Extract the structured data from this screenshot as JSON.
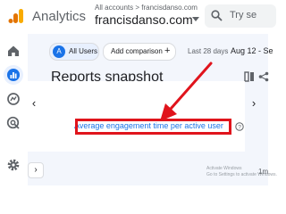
{
  "header": {
    "app_title": "Analytics",
    "account_crumb": "All accounts > francisdanso.com",
    "property_name": "francisdanso.com",
    "search_placeholder": "Try se"
  },
  "nav_rail": {
    "items": [
      {
        "icon": "home-icon"
      },
      {
        "icon": "reports-icon",
        "active": true
      },
      {
        "icon": "explore-icon"
      },
      {
        "icon": "advertising-icon"
      },
      {
        "icon": "settings-icon"
      }
    ]
  },
  "filters": {
    "users_avatar": "A",
    "users_label": "All Users",
    "add_comparison_label": "Add comparison",
    "add_comparison_icon": "+",
    "date_label": "Last 28 days",
    "date_range": "Aug 12 - Se"
  },
  "main": {
    "page_title": "Reports snapshot",
    "metric_link": "Average engagement time per active user",
    "prev_label": "‹",
    "next_label": "›",
    "expand_label": "›",
    "watermark_line1": "Activate Windows",
    "watermark_line2": "Go to Settings to activate Windows.",
    "tiny_suffix": "1m"
  },
  "colors": {
    "accent": "#1a73e8",
    "annotation_red": "#e0141c",
    "logo_orange": "#f9ab00",
    "logo_dark_orange": "#e37400"
  }
}
